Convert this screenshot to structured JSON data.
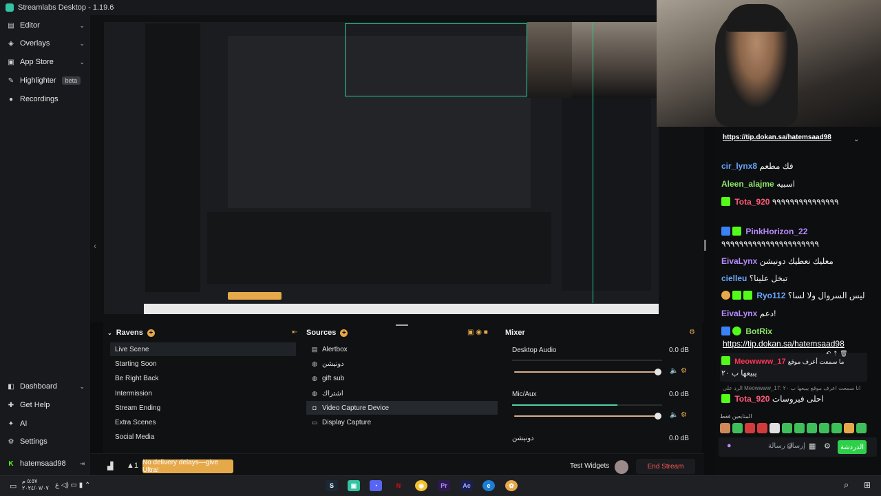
{
  "window": {
    "title": "Streamlabs Desktop - 1.19.6"
  },
  "sidebar": {
    "top_items": [
      {
        "label": "Editor",
        "icon": "editor-icon",
        "chevron": "⌄"
      },
      {
        "label": "Overlays",
        "icon": "overlays-icon",
        "chevron": "⌄"
      },
      {
        "label": "App Store",
        "icon": "app-store-icon",
        "chevron": "⌄"
      },
      {
        "label": "Highlighter",
        "icon": "highlighter-icon",
        "badge": "beta"
      },
      {
        "label": "Recordings",
        "icon": "recordings-icon"
      }
    ],
    "bottom_items": [
      {
        "label": "Dashboard",
        "icon": "dashboard-icon",
        "chevron": "⌄"
      },
      {
        "label": "Get Help",
        "icon": "help-icon"
      },
      {
        "label": "AI",
        "icon": "ai-icon"
      },
      {
        "label": "Settings",
        "icon": "settings-icon"
      }
    ],
    "user": {
      "name": "hatemsaad98",
      "logout_icon": "logout-icon"
    }
  },
  "scenes": {
    "title": "Ravens",
    "items": [
      "Live Scene",
      "Starting Soon",
      "Be Right Back",
      "Intermission",
      "Stream Ending",
      "Extra Scenes",
      "Social Media"
    ],
    "active_index": 0
  },
  "sources": {
    "title": "Sources",
    "items": [
      {
        "label": "Alertbox",
        "icon": "alertbox-icon"
      },
      {
        "label": "دونيشن",
        "icon": "globe-icon"
      },
      {
        "label": "gift sub",
        "icon": "globe-icon"
      },
      {
        "label": "اشتراك",
        "icon": "globe-icon"
      },
      {
        "label": "Video Capture Device",
        "icon": "webcam-icon"
      },
      {
        "label": "Display Capture",
        "icon": "monitor-icon"
      }
    ],
    "active_index": 4
  },
  "mixer": {
    "title": "Mixer",
    "channels": [
      {
        "name": "Desktop Audio",
        "db": "0.0 dB",
        "level": 0.0,
        "volume": 1.0
      },
      {
        "name": "Mic/Aux",
        "db": "0.0 dB",
        "level": 0.7,
        "volume": 1.0
      },
      {
        "name": "دونيشن",
        "db": "0.0 dB"
      }
    ]
  },
  "footer": {
    "ultra_label": "No delivery delays—give Ultra!",
    "test_widgets": "Test Widgets",
    "end_stream": "End Stream",
    "notif_count": "1"
  },
  "chat": {
    "pinned_link": "https://tip.dokan.sa/hatemsaad98",
    "messages": [
      {
        "user": "cir_lynx8",
        "color": "#6aa7ff",
        "text": " فك مطعم"
      },
      {
        "user": "Aleen_alajme",
        "color": "#8fe36b",
        "text": " اسبيه"
      },
      {
        "user": "Tota_920",
        "color": "#ff5a7a",
        "text": " ٩٩٩٩٩٩٩٩٩٩٩٩٩٩٩"
      },
      {
        "user": "PinkHorizon_22",
        "color": "#b98bff",
        "text": ""
      },
      {
        "user": "",
        "color": "#ffffff",
        "text": "٩٩٩٩٩٩٩٩٩٩٩٩٩٩٩٩٩٩٩٩٩٩"
      },
      {
        "user": "EivaLynx",
        "color": "#b98bff",
        "text": " معليك نعطيك دونيشن"
      },
      {
        "user": "cielleu",
        "color": "#6aa7ff",
        "text": " تبخل علينا؟"
      },
      {
        "user": "Ryo112",
        "color": "#6aa7ff",
        "text": " ليس السروال ولا لسا؟"
      },
      {
        "user": "EivaLynx",
        "color": "#b98bff",
        "text": " دعم!"
      },
      {
        "user": "BotRix",
        "color": "#8fe36b",
        "text": ""
      }
    ],
    "botrix_link": "https://tip.dokan.sa/hatemsaad98",
    "highlight": {
      "user": "Meowwww_17",
      "text": " يبيعها ب ٢٠",
      "prefix": "ما سمعت أعرف موقع"
    },
    "reply_hint": "الرد على Meowwww_17: انا سمعت اعرف موقع يبيعها ب ٢٠",
    "last": {
      "user": "Tota_920",
      "text": " احلى فيروسات"
    },
    "followers_label": "المتابعين فقط",
    "input_placeholder": "إرسال رسالة",
    "send_label": "الدردشة"
  },
  "taskbar": {
    "time": "٥:٥٧ م",
    "date": "٢٠٢٤/٠٧/٠٧",
    "apps": [
      "steam-icon",
      "spotify-icon",
      "discord-icon",
      "netflix-icon",
      "chrome-icon",
      "premiere-icon",
      "aftereffects-icon",
      "edge-icon",
      "streamlabs-icon"
    ]
  },
  "colors": {
    "accent": "#31c3a2",
    "ultra": "#e6a94a",
    "end_stream": "#ff5a5a",
    "send": "#2ed04a"
  }
}
